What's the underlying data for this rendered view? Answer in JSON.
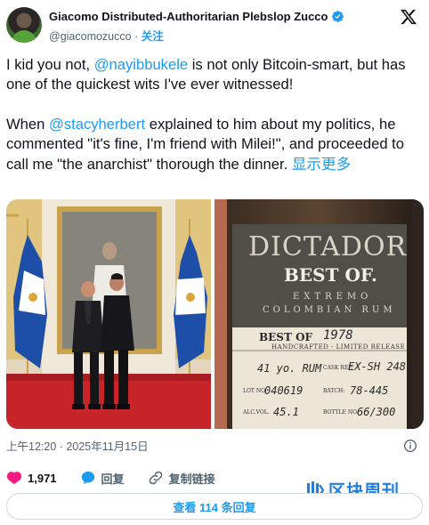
{
  "author": {
    "display_name": "Giacomo Distributed-Authoritarian Plebslop Zucco",
    "handle": "@giacomozucco",
    "separator": "·",
    "follow_label": "关注"
  },
  "tweet": {
    "p1_before": "I kid you not, ",
    "p1_mention": "@nayibbukele",
    "p1_after": " is not only Bitcoin-smart, but has one of the quickest wits I've ever witnessed!",
    "p2_before": "When ",
    "p2_mention": "@stacyherbert",
    "p2_after": " explained to him about my politics, he commented \"it's fine, I'm friend with Milei!\", and proceeded to call me \"the anarchist\" thorough the dinner. ",
    "show_more": "显示更多"
  },
  "bottle_label": {
    "brand": "DICTADOR",
    "edition": "BEST OF.",
    "line1": "EXTREMO",
    "line2": "COLOMBIAN RUM",
    "best_of": "BEST OF",
    "year": "1978",
    "release": "HANDCRAFTED - LIMITED RELEASE",
    "age": "41 yo. RUM",
    "cask_label": "CASK REF.",
    "cask": "EX-SH 248",
    "lot_label": "LOT NO.",
    "lot": "040619",
    "batch_label": "BATCH:",
    "batch": "78-445",
    "alc_label": "ALC.VOL.",
    "alc": "45.1",
    "bottle_label": "BOTTLE NO.",
    "bottle": "66/300"
  },
  "timestamp": "上午12:20 · 2025年11月15日",
  "actions": {
    "likes": "1,971",
    "reply": "回复",
    "copy_link": "复制链接"
  },
  "watermark": "区块周刊",
  "replies_button": "查看 114 条回复",
  "icons": {
    "verified": "verified-badge-icon",
    "x_logo": "x-logo-icon",
    "info": "info-icon",
    "like": "heart-icon",
    "reply": "reply-bubble-icon",
    "link": "link-icon"
  },
  "colors": {
    "link": "#1d9bf0",
    "text": "#0f1419",
    "muted": "#536471",
    "like": "#f91880",
    "watermark": "#1f7de0"
  }
}
